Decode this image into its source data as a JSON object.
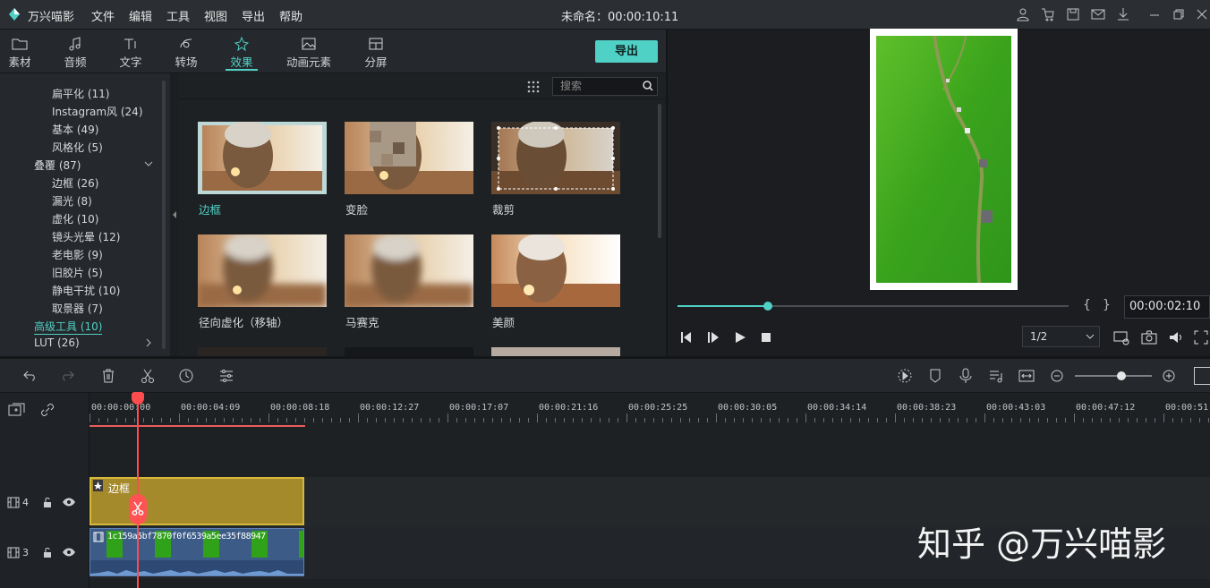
{
  "app": {
    "name": "万兴喵影",
    "menu": [
      "文件",
      "编辑",
      "工具",
      "视图",
      "导出",
      "帮助"
    ],
    "doc_title": "未命名：00:00:10:11"
  },
  "tabs": [
    {
      "label": "素材",
      "icon": "folder-icon"
    },
    {
      "label": "音频",
      "icon": "music-note-icon"
    },
    {
      "label": "文字",
      "icon": "text-icon"
    },
    {
      "label": "转场",
      "icon": "transition-icon"
    },
    {
      "label": "效果",
      "icon": "effects-icon",
      "active": true
    },
    {
      "label": "动画元素",
      "icon": "image-icon"
    },
    {
      "label": "分屏",
      "icon": "split-screen-icon"
    }
  ],
  "export_label": "导出",
  "sidebar": {
    "items": [
      "扁平化 (11)",
      "Instagram风 (24)",
      "基本 (49)",
      "风格化 (5)"
    ],
    "group": "叠覆 (87)",
    "sub": [
      "边框 (26)",
      "漏光 (8)",
      "虚化 (10)",
      "镜头光晕 (12)",
      "老电影 (9)",
      "旧胶片 (5)",
      "静电干扰 (10)",
      "取景器 (7)"
    ],
    "advanced": "高级工具 (10)",
    "lut": "LUT (26)"
  },
  "search": {
    "placeholder": "搜索"
  },
  "effects": [
    {
      "label": "边框",
      "selected": true
    },
    {
      "label": "变脸"
    },
    {
      "label": "裁剪"
    },
    {
      "label": "径向虚化（移轴）"
    },
    {
      "label": "马赛克"
    },
    {
      "label": "美颜"
    }
  ],
  "preview": {
    "timecode": "00:00:02:10",
    "ratio": "1/2",
    "progress": 0.23
  },
  "ruler": [
    "00:00:00:00",
    "00:00:04:09",
    "00:00:08:18",
    "00:00:12:27",
    "00:00:17:07",
    "00:00:21:16",
    "00:00:25:25",
    "00:00:30:05",
    "00:00:34:14",
    "00:00:38:23",
    "00:00:43:03",
    "00:00:47:12",
    "00:00:51"
  ],
  "tracks": [
    {
      "num": "4",
      "clip": "边框"
    },
    {
      "num": "3",
      "clip": "1c159a5bf7870f0f6539a5ee35f88947"
    }
  ],
  "watermark": "知乎 @万兴喵影"
}
